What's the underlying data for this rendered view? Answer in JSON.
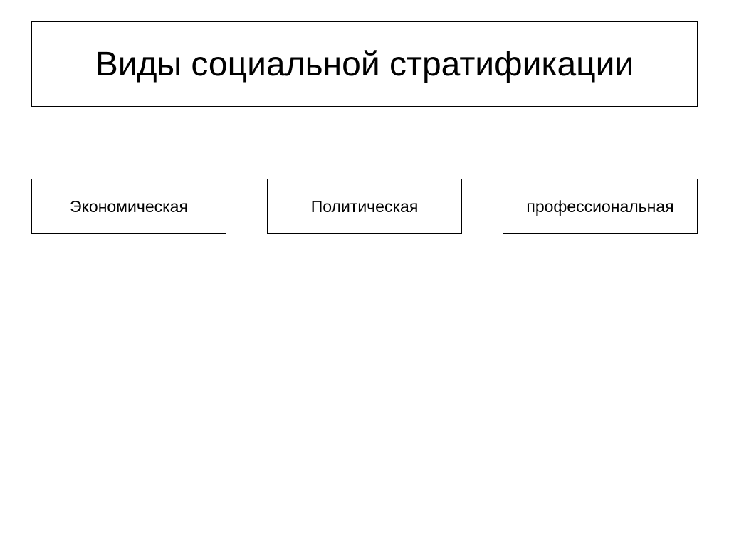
{
  "title": "Виды социальной стратификации",
  "items": [
    "Экономическая",
    "Политическая",
    "профессиональная"
  ]
}
